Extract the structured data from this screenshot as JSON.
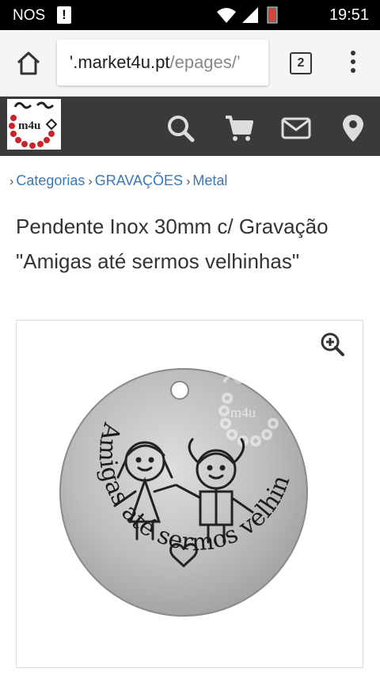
{
  "status_bar": {
    "carrier": "NOS",
    "alert_symbol": "!",
    "time": "19:51",
    "icons": [
      "wifi-icon",
      "signal-icon",
      "battery-low-icon"
    ]
  },
  "browser": {
    "url_host": "'.market4u.pt",
    "url_path": "/epages/’",
    "tab_count": "2",
    "icons": [
      "home-icon",
      "tabs-icon",
      "overflow-menu-icon"
    ]
  },
  "site_header": {
    "logo_text": "m4u",
    "icons": [
      "search-icon",
      "cart-icon",
      "mail-icon",
      "location-pin-icon"
    ],
    "background": "#3a3a3a"
  },
  "breadcrumb": {
    "items": [
      "Categorias",
      "GRAVAÇÕES",
      "Metal"
    ],
    "link_color": "#3b78b4"
  },
  "product": {
    "title": "Pendente Inox 30mm c/ Gravação \"Amigas até sermos velhinhas\"",
    "image": {
      "engraving_text": "Amigas até sermos velhinhas",
      "watermark_text": "m4u",
      "zoom_icon": "zoom-in-icon"
    }
  }
}
